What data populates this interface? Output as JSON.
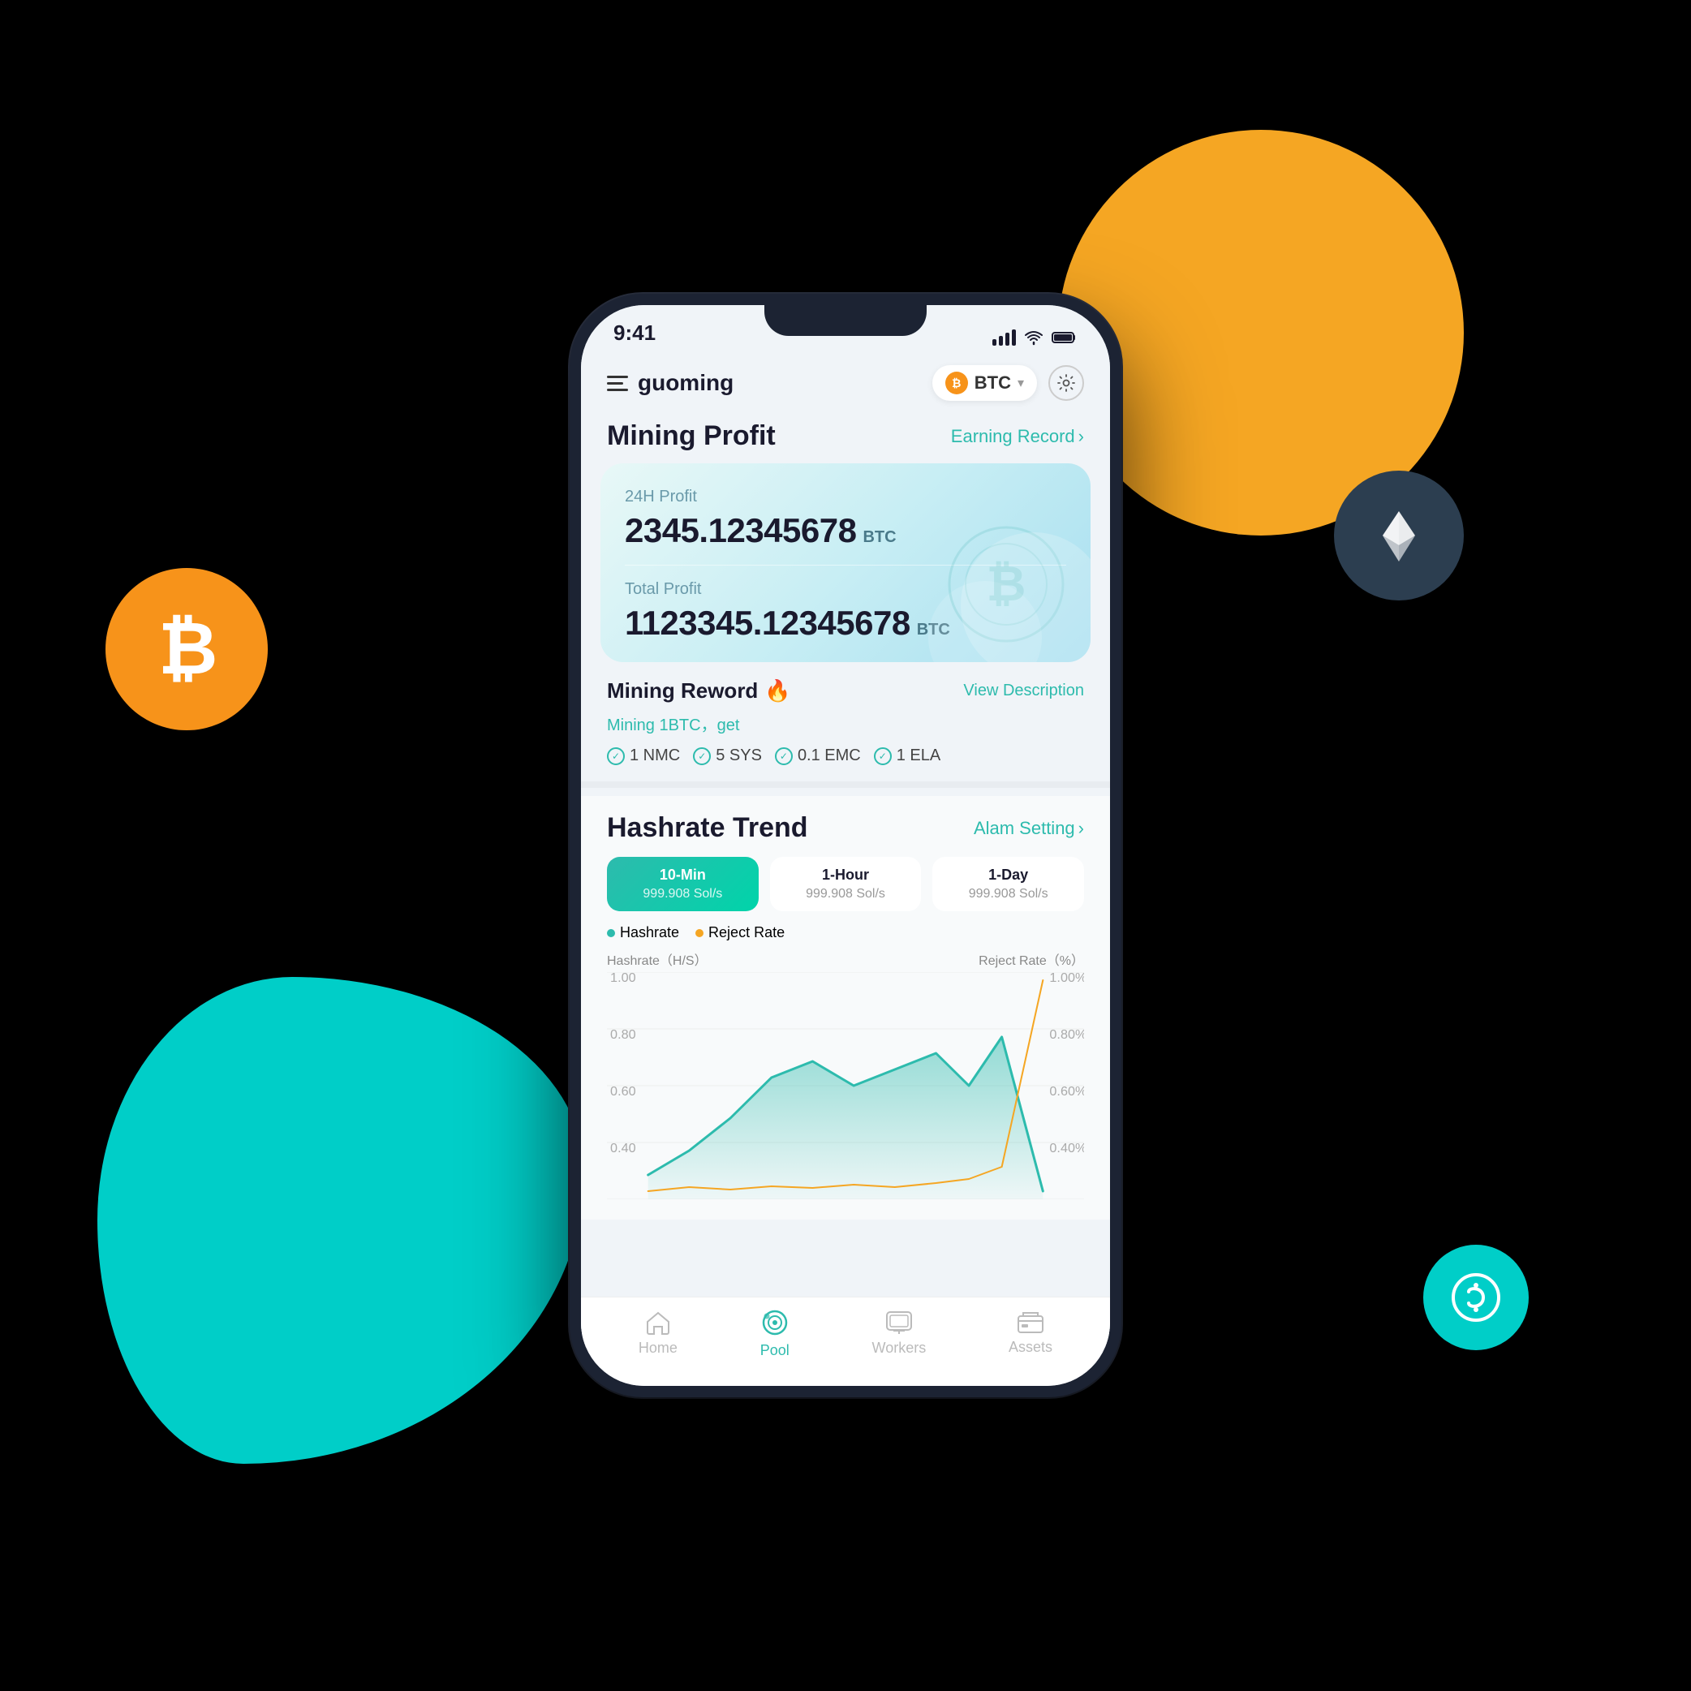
{
  "background": {
    "btcCoin": "₿",
    "ethCoin": "ETH",
    "cyanCoin": "C"
  },
  "statusBar": {
    "time": "9:41"
  },
  "header": {
    "username": "guoming",
    "btcLabel": "BTC",
    "settingsLabel": "⚙"
  },
  "miningProfit": {
    "title": "Mining Profit",
    "earningRecord": "Earning Record",
    "earningRecordChevron": "›",
    "profit24hLabel": "24H Profit",
    "profit24hAmount": "2345.12345678",
    "profit24hCurrency": "BTC",
    "totalProfitLabel": "Total Profit",
    "totalProfitAmount": "1123345.12345678",
    "totalProfitCurrency": "BTC"
  },
  "miningReward": {
    "title": "Mining Reword",
    "fireEmoji": "🔥",
    "viewDescription": "View Description",
    "subtitle": "Mining 1BTC，get",
    "rewards": [
      {
        "label": "1 NMC"
      },
      {
        "label": "5 SYS"
      },
      {
        "label": "0.1 EMC"
      },
      {
        "label": "1 ELA"
      }
    ]
  },
  "hashrateTrend": {
    "title": "Hashrate Trend",
    "alarmSetting": "Alam Setting",
    "alarmChevron": "›",
    "tabs": [
      {
        "label": "10-Min",
        "value": "999.908 Sol/s",
        "active": true
      },
      {
        "label": "1-Hour",
        "value": "999.908 Sol/s",
        "active": false
      },
      {
        "label": "1-Day",
        "value": "999.908 Sol/s",
        "active": false
      }
    ],
    "legend": {
      "hashrate": "Hashrate",
      "rejectRate": "Reject Rate",
      "hashrateColor": "#2DBBAD",
      "rejectRateColor": "#F5A623"
    },
    "chartLabels": {
      "left": "Hashrate（H/S）",
      "right": "Reject Rate（%）"
    },
    "yAxisLeft": [
      "1.00",
      "0.80",
      "0.60",
      "0.40"
    ],
    "yAxisRight": [
      "1.00%",
      "0.80%",
      "0.60%",
      "0.40%"
    ]
  },
  "bottomNav": [
    {
      "label": "Home",
      "active": false,
      "icon": "⌂"
    },
    {
      "label": "Pool",
      "active": true,
      "icon": "◎"
    },
    {
      "label": "Workers",
      "active": false,
      "icon": "⊡"
    },
    {
      "label": "Assets",
      "active": false,
      "icon": "▣"
    }
  ]
}
